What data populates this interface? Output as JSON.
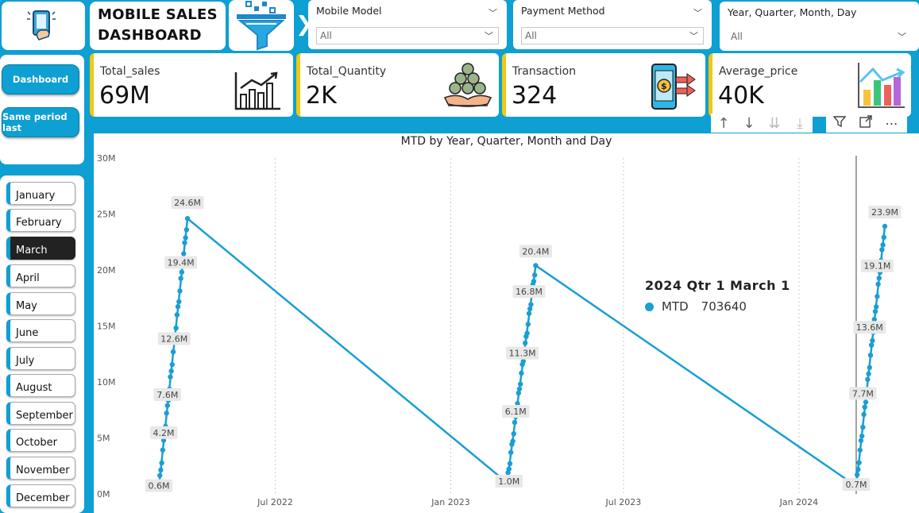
{
  "header": {
    "title_line1": "MOBILE SALES",
    "title_line2": "DASHBOARD"
  },
  "slicers": [
    {
      "label": "Mobile Model",
      "value": "All"
    },
    {
      "label": "Payment Method",
      "value": "All"
    },
    {
      "label": "Year, Quarter, Month, Day",
      "value": "All"
    }
  ],
  "nav": {
    "dashboard": "Dashboard",
    "same_period": "Same period last"
  },
  "months": [
    "January",
    "February",
    "March",
    "April",
    "May",
    "June",
    "July",
    "August",
    "September",
    "October",
    "November",
    "December"
  ],
  "active_month": "March",
  "kpis": [
    {
      "label": "Total_sales",
      "value": "69M"
    },
    {
      "label": "Total_Quantity",
      "value": "2K"
    },
    {
      "label": "Transaction",
      "value": "324"
    },
    {
      "label": "Average_price",
      "value": "40K"
    }
  ],
  "colors": {
    "accent": "#0e9fd3",
    "kpi_border": "#f2c811",
    "line": "#1a9ed4"
  },
  "tooltip": {
    "title": "2024 Qtr 1 March 1",
    "series": "MTD",
    "value": "703640"
  },
  "chart_data": {
    "type": "line",
    "title": "MTD by Year, Quarter, Month and Day",
    "xlabel": "",
    "ylabel": "",
    "y_ticks": [
      "0M",
      "5M",
      "10M",
      "15M",
      "20M",
      "25M",
      "30M"
    ],
    "ylim": [
      0,
      30
    ],
    "x_ticks": [
      "Jul 2022",
      "Jan 2023",
      "Jul 2023",
      "Jan 2024"
    ],
    "segments": [
      {
        "start": "2022-03-01",
        "end": "2022-03-31",
        "start_value": 0.6,
        "end_value": 24.6
      },
      {
        "start": "2023-03-01",
        "end": "2023-03-31",
        "start_value": 1.0,
        "end_value": 20.4
      },
      {
        "start": "2024-03-01",
        "end": "2024-03-31",
        "start_value": 0.7,
        "end_value": 23.9
      }
    ],
    "data_labels": [
      {
        "date": "2022-03-01",
        "value": 0.6,
        "label": "0.6M"
      },
      {
        "date": "2022-03-06",
        "value": 4.2,
        "label": "4.2M"
      },
      {
        "date": "2022-03-10",
        "value": 7.6,
        "label": "7.6M"
      },
      {
        "date": "2022-03-17",
        "value": 12.6,
        "label": "12.6M"
      },
      {
        "date": "2022-03-24",
        "value": 19.4,
        "label": "19.4M"
      },
      {
        "date": "2022-03-31",
        "value": 24.6,
        "label": "24.6M"
      },
      {
        "date": "2023-03-03",
        "value": 1.0,
        "label": "1.0M"
      },
      {
        "date": "2023-03-10",
        "value": 6.1,
        "label": "6.1M"
      },
      {
        "date": "2023-03-17",
        "value": 11.3,
        "label": "11.3M"
      },
      {
        "date": "2023-03-24",
        "value": 16.8,
        "label": "16.8M"
      },
      {
        "date": "2023-03-31",
        "value": 20.4,
        "label": "20.4M"
      },
      {
        "date": "2024-03-01",
        "value": 0.7,
        "label": "0.7M"
      },
      {
        "date": "2024-03-08",
        "value": 7.7,
        "label": "7.7M"
      },
      {
        "date": "2024-03-15",
        "value": 13.6,
        "label": "13.6M"
      },
      {
        "date": "2024-03-23",
        "value": 19.1,
        "label": "19.1M"
      },
      {
        "date": "2024-03-31",
        "value": 23.9,
        "label": "23.9M"
      }
    ],
    "hover_date": "2024-03-01",
    "legend": "none",
    "grid": "vertical dotted"
  }
}
